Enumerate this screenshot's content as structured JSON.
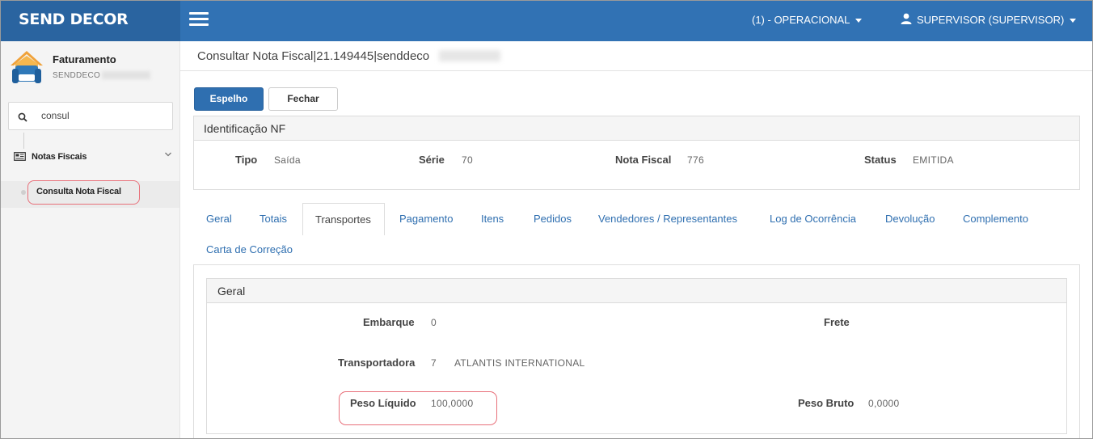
{
  "brand": "SEND DECOR",
  "header": {
    "context_menu": "(1) - OPERACIONAL",
    "user_menu": "SUPERVISOR (SUPERVISOR)"
  },
  "sidebar": {
    "app_name": "Faturamento",
    "app_org": "SENDDECO",
    "search_value": "consul",
    "group_label": "Notas Fiscais",
    "sub_item": "Consulta Nota Fiscal"
  },
  "page": {
    "title": "Consultar Nota Fiscal|21.149445|senddeco"
  },
  "toolbar": {
    "espelho": "Espelho",
    "fechar": "Fechar"
  },
  "nf": {
    "heading": "Identificação NF",
    "tipo_label": "Tipo",
    "tipo_value": "Saída",
    "serie_label": "Série",
    "serie_value": "70",
    "nota_label": "Nota Fiscal",
    "nota_value": "776",
    "status_label": "Status",
    "status_value": "EMITIDA"
  },
  "tabs": [
    "Geral",
    "Totais",
    "Transportes",
    "Pagamento",
    "Itens",
    "Pedidos",
    "Vendedores / Representantes",
    "Log de Ocorrência",
    "Devolução",
    "Complemento",
    "Carta de Correção"
  ],
  "geral": {
    "heading": "Geral",
    "embarque_label": "Embarque",
    "embarque_value": "0",
    "frete_label": "Frete",
    "transportadora_label": "Transportadora",
    "transportadora_code": "7",
    "transportadora_name": "ATLANTIS INTERNATIONAL",
    "peso_liquido_label": "Peso Líquido",
    "peso_liquido_value": "100,0000",
    "peso_bruto_label": "Peso Bruto",
    "peso_bruto_value": "0,0000"
  },
  "colors": {
    "topbar": "#3172b4",
    "brand_bg": "#2a64a0",
    "primary_button": "#2f6fb0",
    "highlight": "#e8707a"
  },
  "icons": {
    "hamburger": "menu-icon",
    "user": "user-icon",
    "search": "search-icon",
    "group": "newspaper-icon",
    "chevron": "chevron-down-icon",
    "logo": "sofa-house-icon"
  }
}
